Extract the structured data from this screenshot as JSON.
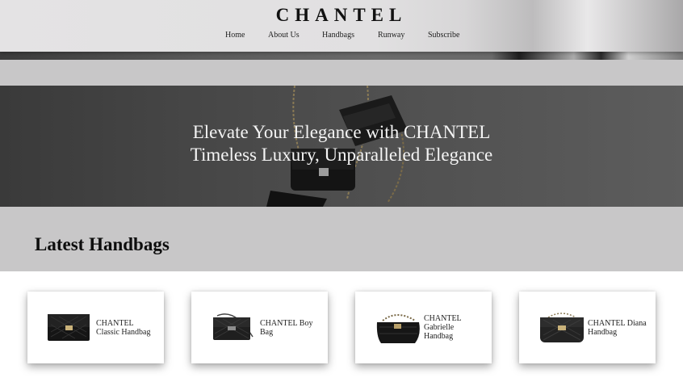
{
  "header": {
    "brand": "CHANTEL",
    "nav": [
      "Home",
      "About Us",
      "Handbags",
      "Runway",
      "Subscribe"
    ]
  },
  "hero": {
    "line1": "Elevate Your Elegance with CHANTEL",
    "line2": "Timeless Luxury, Unparalleled Elegance"
  },
  "latest": {
    "title": "Latest Handbags",
    "items": [
      {
        "name": "CHANTEL Classic Handbag"
      },
      {
        "name": "CHANTEL Boy Bag"
      },
      {
        "name": "CHANTEL Gabrielle Handbag"
      },
      {
        "name": "CHANTEL Diana Handbag"
      }
    ]
  }
}
